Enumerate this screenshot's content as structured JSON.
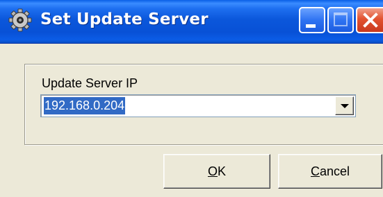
{
  "window": {
    "title": "Set Update Server",
    "icon": "gear-icon",
    "controls": {
      "minimize_icon": "minimize-icon",
      "maximize_icon": "maximize-icon",
      "close_icon": "close-icon"
    },
    "colors": {
      "titlebar": "#0b57db",
      "close_button": "#e2522f",
      "selection": "#316ac5",
      "dialog_background": "#ece9d8"
    }
  },
  "form": {
    "field_label": "Update Server IP",
    "server_ip_value": "192.168.0.204",
    "dropdown_icon": "chevron-down-icon"
  },
  "buttons": {
    "ok": {
      "mnemonic": "O",
      "rest": "K"
    },
    "cancel": {
      "mnemonic": "C",
      "rest": "ancel"
    }
  }
}
